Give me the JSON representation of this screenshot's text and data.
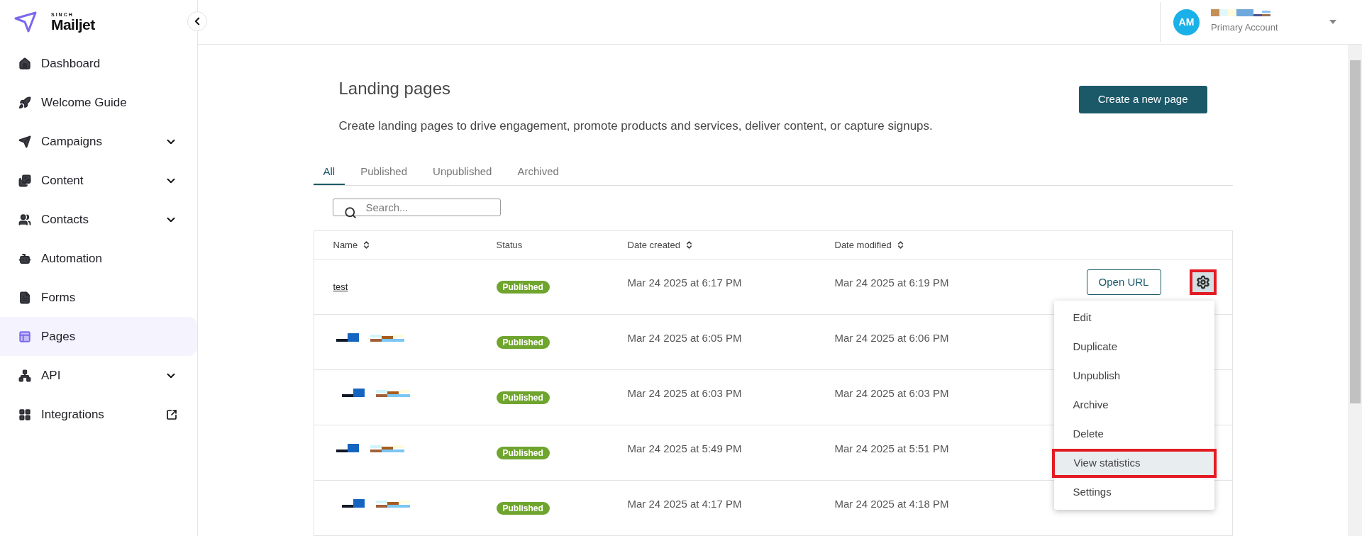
{
  "brand": {
    "over": "SINCH",
    "name": "Mailjet"
  },
  "sidebar": {
    "items": [
      {
        "label": "Dashboard",
        "expandable": false,
        "external": false,
        "selected": false
      },
      {
        "label": "Welcome Guide",
        "expandable": false,
        "external": false,
        "selected": false
      },
      {
        "label": "Campaigns",
        "expandable": true,
        "external": false,
        "selected": false
      },
      {
        "label": "Content",
        "expandable": true,
        "external": false,
        "selected": false
      },
      {
        "label": "Contacts",
        "expandable": true,
        "external": false,
        "selected": false
      },
      {
        "label": "Automation",
        "expandable": false,
        "external": false,
        "selected": false
      },
      {
        "label": "Forms",
        "expandable": false,
        "external": false,
        "selected": false
      },
      {
        "label": "Pages",
        "expandable": false,
        "external": false,
        "selected": true
      },
      {
        "label": "API",
        "expandable": true,
        "external": false,
        "selected": false
      },
      {
        "label": "Integrations",
        "expandable": false,
        "external": true,
        "selected": false
      }
    ]
  },
  "account": {
    "initials": "AM",
    "subtitle": "Primary Account"
  },
  "page": {
    "title": "Landing pages",
    "description": "Create landing pages to drive engagement, promote products and services, deliver content, or capture signups.",
    "create_button": "Create a new page"
  },
  "tabs": [
    {
      "label": "All",
      "selected": true
    },
    {
      "label": "Published",
      "selected": false
    },
    {
      "label": "Unpublished",
      "selected": false
    },
    {
      "label": "Archived",
      "selected": false
    }
  ],
  "search": {
    "placeholder": "Search..."
  },
  "table": {
    "columns": [
      {
        "label": "Name",
        "sortable": true
      },
      {
        "label": "Status",
        "sortable": false
      },
      {
        "label": "Date created",
        "sortable": true
      },
      {
        "label": "Date modified",
        "sortable": true
      }
    ],
    "rows": [
      {
        "kind": "link",
        "name": "test",
        "status": "Published",
        "created": "Mar 24 2025 at 6:17 PM",
        "modified": "Mar 24 2025 at 6:19 PM",
        "open_url": "Open URL"
      },
      {
        "kind": "redacted",
        "status": "Published",
        "created": "Mar 24 2025 at 6:05 PM",
        "modified": "Mar 24 2025 at 6:06 PM"
      },
      {
        "kind": "redacted",
        "status": "Published",
        "created": "Mar 24 2025 at 6:03 PM",
        "modified": "Mar 24 2025 at 6:03 PM"
      },
      {
        "kind": "redacted",
        "status": "Published",
        "created": "Mar 24 2025 at 5:49 PM",
        "modified": "Mar 24 2025 at 5:51 PM"
      },
      {
        "kind": "redacted",
        "status": "Published",
        "created": "Mar 24 2025 at 4:17 PM",
        "modified": "Mar 24 2025 at 4:18 PM"
      }
    ]
  },
  "gear_highlighted": true,
  "menu": {
    "items": [
      {
        "label": "Edit",
        "highlighted": false
      },
      {
        "label": "Duplicate",
        "highlighted": false
      },
      {
        "label": "Unpublish",
        "highlighted": false
      },
      {
        "label": "Archive",
        "highlighted": false
      },
      {
        "label": "Delete",
        "highlighted": false
      },
      {
        "label": "View statistics",
        "highlighted": true
      },
      {
        "label": "Settings",
        "highlighted": false
      }
    ]
  }
}
